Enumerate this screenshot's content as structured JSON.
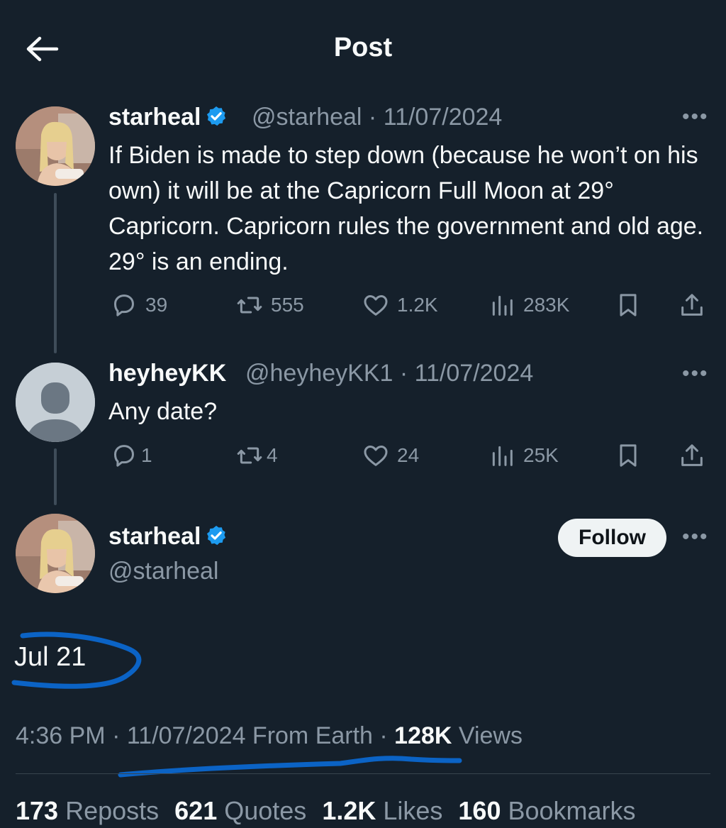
{
  "header": {
    "title": "Post",
    "back_icon": "arrow-left-icon"
  },
  "colors": {
    "background": "#15202b",
    "accent": "#1d9bf0",
    "muted": "#8b98a5",
    "marker": "#0b63c5"
  },
  "tweets": [
    {
      "name": "starheal",
      "handle_date": "@starheal · 11/07/2024",
      "text": "If Biden is made to step down (because he won’t on his own) it will be at the Capricorn Full Moon at 29° Capricorn. Capricorn rules the government and old age. 29° is an ending.",
      "replies": "39",
      "reposts": "555",
      "likes": "1.2K",
      "views": "283K"
    },
    {
      "name": "heyheyKK",
      "handle_date": "@heyheyKK1 · 11/07/2024",
      "text": "Any date?",
      "replies": "1",
      "reposts": "4",
      "likes": "24",
      "views": "25K"
    }
  ],
  "main": {
    "name": "starheal",
    "handle": "@starheal",
    "follow_label": "Follow",
    "text": "Jul 21",
    "time": "4:36 PM · 11/07/2024 From Earth · ",
    "views_count": "128K",
    "views_label": " Views",
    "stats": {
      "reposts_count": "173",
      "reposts_label": " Reposts",
      "quotes_count": "621",
      "quotes_label": " Quotes",
      "likes_count": "1.2K",
      "likes_label": " Likes",
      "bookmarks_count": "160",
      "bookmarks_label": " Bookmarks"
    }
  }
}
